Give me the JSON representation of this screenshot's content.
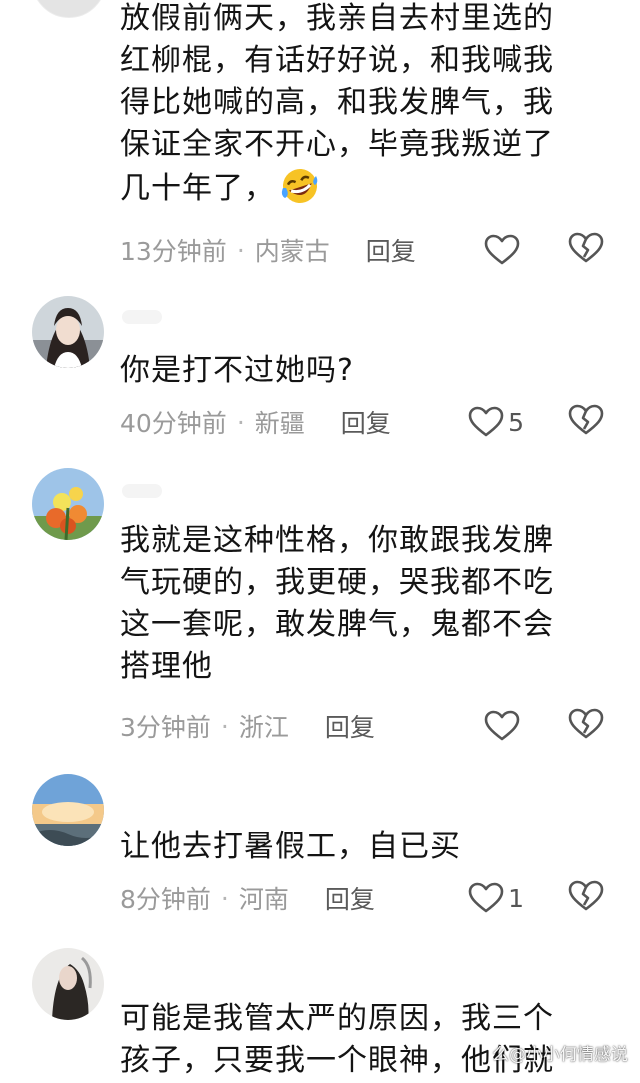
{
  "comments": [
    {
      "text": "放假前俩天，我亲自去村里选的\n红柳棍，有话好好说，和我喊我\n得比她喊的高，和我发脾气，我\n保证全家不开心，毕竟我叛逆了\n几十年了，",
      "emoji": "rofl-emoji",
      "time": "13分钟前",
      "region": "内蒙古",
      "reply": "回复",
      "likes": ""
    },
    {
      "text": "你是打不过她吗?",
      "time": "40分钟前",
      "region": "新疆",
      "reply": "回复",
      "likes": "5"
    },
    {
      "text": "我就是这种性格，你敢跟我发脾\n气玩硬的，我更硬，哭我都不吃\n这一套呢，敢发脾气，鬼都不会\n搭理他",
      "time": "3分钟前",
      "region": "浙江",
      "reply": "回复",
      "likes": ""
    },
    {
      "text": "让他去打暑假工，自已买",
      "time": "8分钟前",
      "region": "河南",
      "reply": "回复",
      "likes": "1"
    },
    {
      "text": "可能是我管太严的原因，我三个\n孩子，只要我一个眼神，他们就",
      "time": "",
      "region": "",
      "reply": "",
      "likes": ""
    }
  ],
  "separator": "·",
  "watermark": "么@小小何情感说",
  "icons": {
    "like": "heart-outline-icon",
    "dislike": "broken-heart-icon"
  },
  "colors": {
    "text": "#141414",
    "meta": "#9a9a9a",
    "icon": "#555555"
  }
}
